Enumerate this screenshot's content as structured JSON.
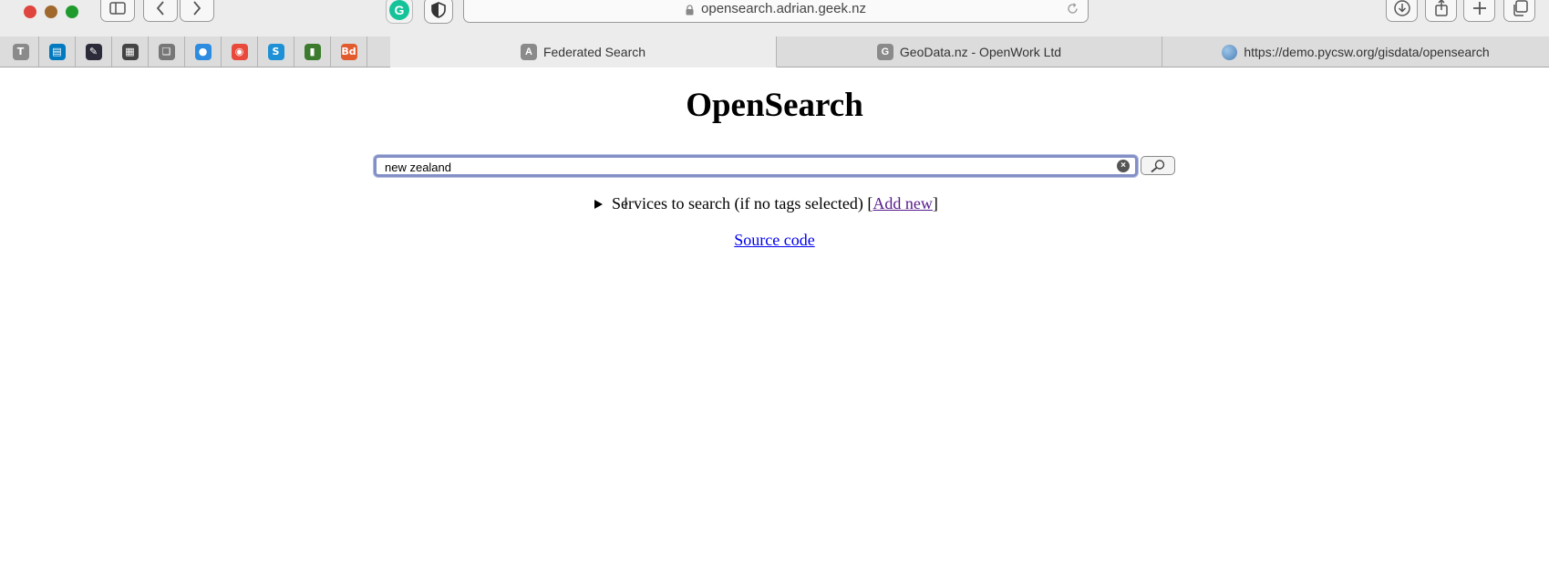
{
  "browser": {
    "url": "opensearch.adrian.geek.nz",
    "pinned_tabs": [
      {
        "icon": "t-app-icon",
        "letter": "T",
        "color": "#8a8a8a"
      },
      {
        "icon": "trello-icon",
        "letter": "▤",
        "color": "#0079bf"
      },
      {
        "icon": "pencil-note-icon",
        "letter": "✎",
        "color": "#2b2b3a"
      },
      {
        "icon": "qr-code-icon",
        "letter": "▦",
        "color": "#444444"
      },
      {
        "icon": "script-icon",
        "letter": "❏",
        "color": "#777777"
      },
      {
        "icon": "chat-bubble-icon",
        "letter": "●",
        "color": "#2d8ce0"
      },
      {
        "icon": "red-circle-app-icon",
        "letter": "◉",
        "color": "#e8493a"
      },
      {
        "icon": "s-app-icon",
        "letter": "S",
        "color": "#1e90d6"
      },
      {
        "icon": "bars-chart-icon",
        "letter": "▮",
        "color": "#3c7a2e"
      },
      {
        "icon": "bd-app-icon",
        "letter": "Bd",
        "color": "#e25b2f"
      }
    ],
    "tabs": [
      {
        "favicon": "A",
        "label": "Federated Search"
      },
      {
        "favicon": "G",
        "label": "GeoData.nz - OpenWork Ltd"
      },
      {
        "favicon": "",
        "label": "https://demo.pycsw.org/gisdata/opensearch"
      }
    ],
    "grammarly_letter": "G"
  },
  "page": {
    "title": "OpenSearch",
    "search_value": "new zealand",
    "services_text": "Services to search (if no tags selected) [",
    "add_new_label": "Add new",
    "services_close": "]",
    "source_code_label": "Source code"
  }
}
